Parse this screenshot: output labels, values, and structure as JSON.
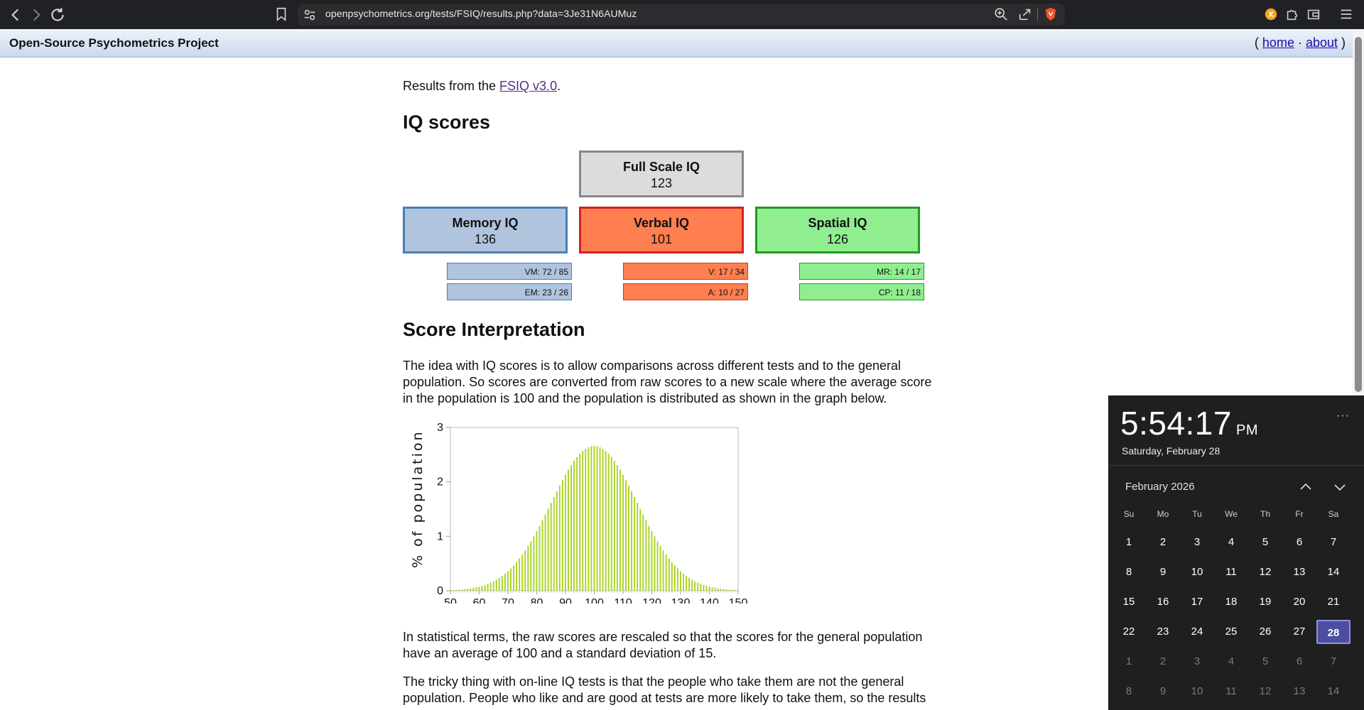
{
  "browser": {
    "url": "openpsychometrics.org/tests/FSIQ/results.php?data=3Je31N6AUMuz"
  },
  "site": {
    "title": "Open-Source Psychometrics Project",
    "links_open": "( ",
    "home": "home",
    "sep": " · ",
    "about": "about",
    "links_close": " )"
  },
  "intro": {
    "prefix": "Results from the ",
    "link": "FSIQ v3.0",
    "suffix": "."
  },
  "iq": {
    "heading": "IQ scores",
    "full": {
      "label": "Full Scale IQ",
      "value": "123"
    },
    "memory": {
      "label": "Memory IQ",
      "value": "136",
      "subs": [
        "VM: 72 / 85",
        "EM: 23 / 26"
      ]
    },
    "verbal": {
      "label": "Verbal IQ",
      "value": "101",
      "subs": [
        "V: 17 / 34",
        "A: 10 / 27"
      ]
    },
    "spatial": {
      "label": "Spatial IQ",
      "value": "126",
      "subs": [
        "MR: 14 / 17",
        "CP: 11 / 18"
      ]
    }
  },
  "interpretation": {
    "heading": "Score Interpretation",
    "p1": "The idea with IQ scores is to allow comparisons across different tests and to the general population. So scores are converted from raw scores to a new scale where the average score in the population is 100 and the population is distributed as shown in the graph below.",
    "p2": "In statistical terms, the raw scores are rescaled so that the scores for the general population have an average of 100 and a standard deviation of 15.",
    "p3": "The tricky thing with on-line IQ tests is that the people who take them are not the general population. People who like and are good at tests are more likely to take them, so the results have"
  },
  "chart_data": {
    "type": "bar",
    "ylabel": "% of population",
    "xlabel": "",
    "xlim": [
      50,
      150
    ],
    "ylim": [
      0,
      3
    ],
    "xticks": [
      50,
      60,
      70,
      80,
      90,
      100,
      110,
      120,
      130,
      140,
      150
    ],
    "yticks": [
      0,
      1,
      2,
      3
    ],
    "distribution": {
      "mean": 100,
      "sd": 15,
      "step": 1
    },
    "color": "#a8d41e",
    "peak_value": 2.66
  },
  "clock": {
    "time": "5:54:17",
    "ampm": "PM",
    "date": "Saturday, February 28",
    "more": "···",
    "month": "February 2026",
    "weekdays": [
      "Su",
      "Mo",
      "Tu",
      "We",
      "Th",
      "Fr",
      "Sa"
    ],
    "weeks": [
      [
        "1",
        "2",
        "3",
        "4",
        "5",
        "6",
        "7"
      ],
      [
        "8",
        "9",
        "10",
        "11",
        "12",
        "13",
        "14"
      ],
      [
        "15",
        "16",
        "17",
        "18",
        "19",
        "20",
        "21"
      ],
      [
        "22",
        "23",
        "24",
        "25",
        "26",
        "27",
        "28"
      ],
      [
        "1",
        "2",
        "3",
        "4",
        "5",
        "6",
        "7"
      ],
      [
        "8",
        "9",
        "10",
        "11",
        "12",
        "13",
        "14"
      ]
    ],
    "today": "28"
  }
}
